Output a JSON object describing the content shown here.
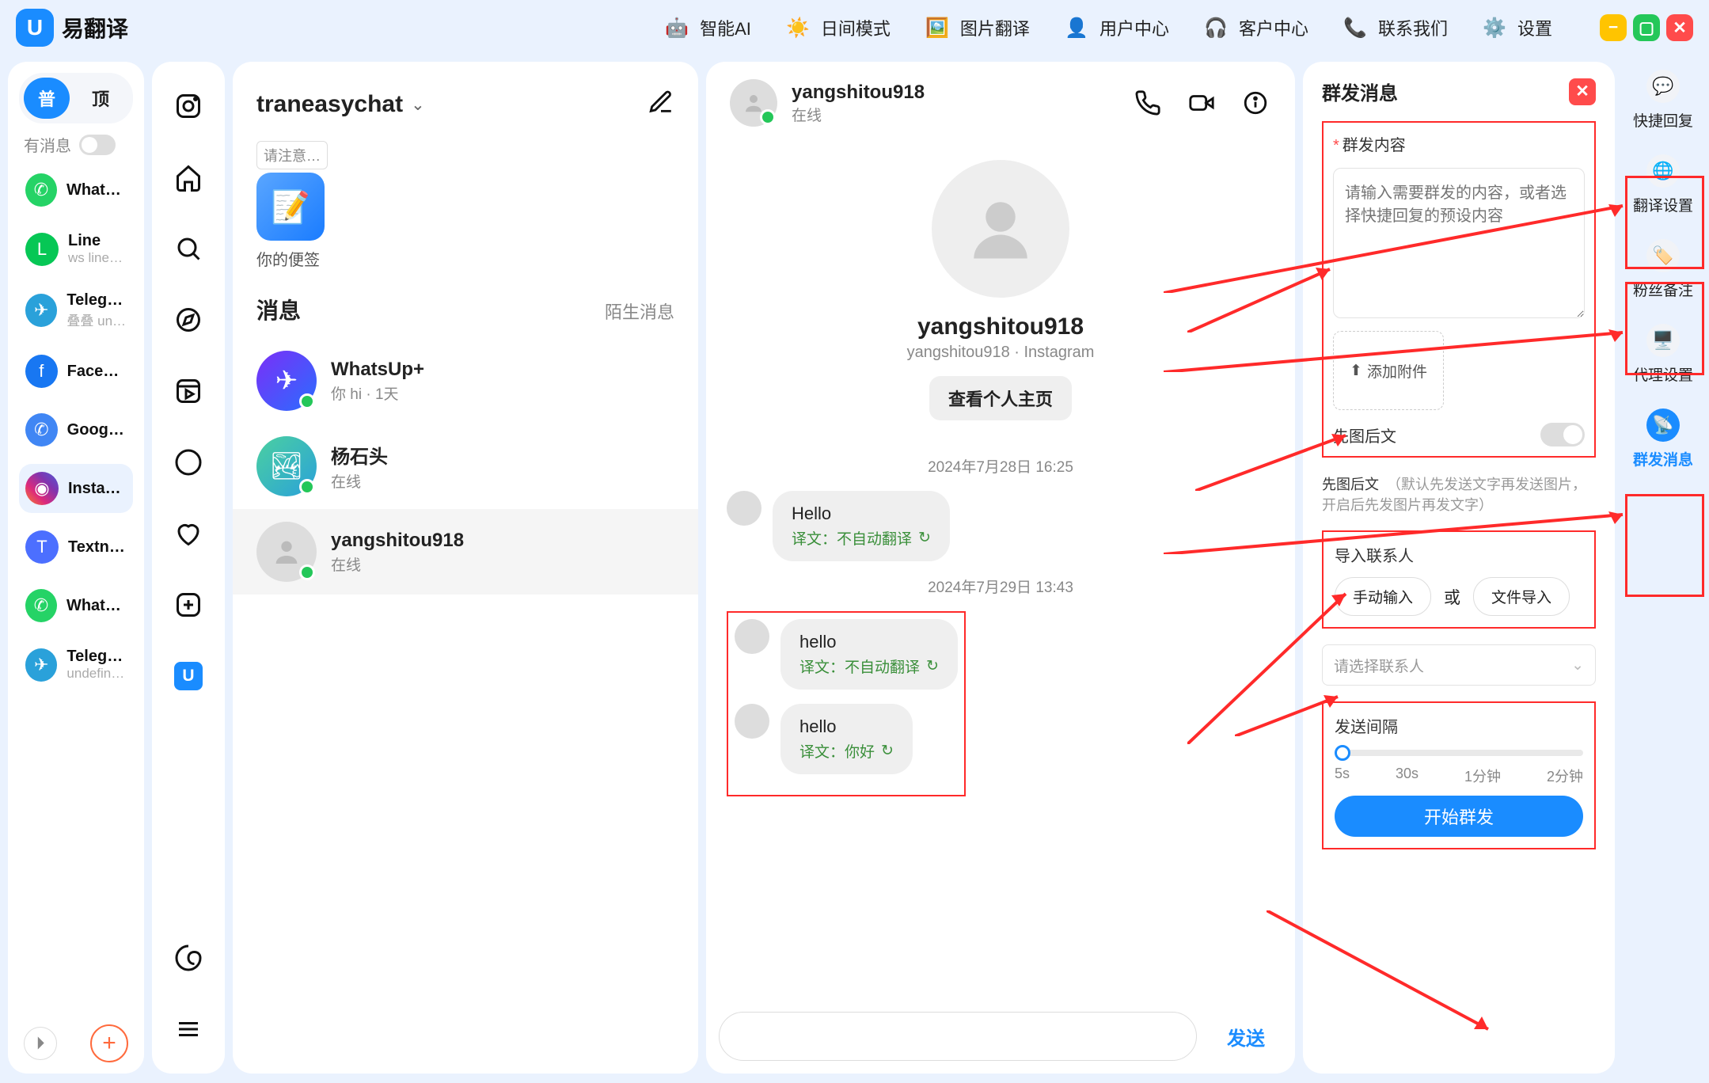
{
  "app": {
    "name": "易翻译",
    "top_actions": {
      "ai": "智能AI",
      "day_mode": "日间模式",
      "image_translate": "图片翻译",
      "user_center": "用户中心",
      "support": "客户中心",
      "contact": "联系我们",
      "settings": "设置"
    }
  },
  "leftrail": {
    "chips": {
      "pin": "普",
      "top": "顶"
    },
    "has_msg_label": "有消息",
    "accounts": [
      {
        "name": "Whats…",
        "sub": ""
      },
      {
        "name": "Line",
        "sub": "ws line…"
      },
      {
        "name": "Telegr…",
        "sub": "叠叠 un…"
      },
      {
        "name": "Faceb…",
        "sub": ""
      },
      {
        "name": "Googl…",
        "sub": ""
      },
      {
        "name": "Insta…",
        "sub": ""
      },
      {
        "name": "Textn…",
        "sub": ""
      },
      {
        "name": "Whats…",
        "sub": ""
      },
      {
        "name": "Telegr…",
        "sub": "undefin…"
      }
    ]
  },
  "convcol": {
    "title": "traneasychat",
    "note_hint": "请注意…",
    "note_caption": "你的便签",
    "messages_header": "消息",
    "strangers": "陌生消息",
    "items": [
      {
        "name": "WhatsUp+",
        "sub": "你 hi · 1天"
      },
      {
        "name": "杨石头",
        "sub": "在线"
      },
      {
        "name": "yangshitou918",
        "sub": "在线"
      }
    ]
  },
  "chat": {
    "contact_name": "yangshitou918",
    "status": "在线",
    "profile_sub": "yangshitou918 · Instagram",
    "profile_btn": "查看个人主页",
    "date1": "2024年7月28日 16:25",
    "date2": "2024年7月29日 13:43",
    "msgs": [
      {
        "text": "Hello",
        "trans": "译文：不自动翻译"
      },
      {
        "text": "hello",
        "trans": "译文：不自动翻译"
      },
      {
        "text": "hello",
        "trans": "译文：你好"
      }
    ],
    "send": "发送"
  },
  "broadcast": {
    "title": "群发消息",
    "content_label": "群发内容",
    "content_placeholder": "请输入需要群发的内容，或者选择快捷回复的预设内容",
    "attach": "添加附件",
    "img_first": "先图后文",
    "img_first_help_label": "先图后文",
    "img_first_help": "（默认先发送文字再发送图片，开启后先发图片再发文字）",
    "import_label": "导入联系人",
    "manual_input": "手动输入",
    "or": "或",
    "file_import": "文件导入",
    "select_placeholder": "请选择联系人",
    "interval_label": "发送间隔",
    "ticks": {
      "a": "5s",
      "b": "30s",
      "c": "1分钟",
      "d": "2分钟"
    },
    "start": "开始群发"
  },
  "toolrail": {
    "quick_reply": "快捷回复",
    "translate_settings": "翻译设置",
    "fan_notes": "粉丝备注",
    "proxy_settings": "代理设置",
    "broadcast": "群发消息"
  }
}
